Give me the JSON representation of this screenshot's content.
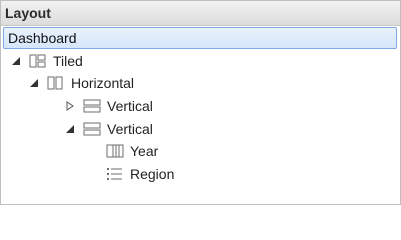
{
  "header": {
    "title": "Layout"
  },
  "root": {
    "label": "Dashboard"
  },
  "tree": [
    {
      "label": "Tiled",
      "icon": "tiled-layout-icon",
      "expander": "expanded"
    },
    {
      "label": "Horizontal",
      "icon": "horizontal-layout-icon",
      "expander": "expanded"
    },
    {
      "label": "Vertical",
      "icon": "vertical-layout-icon",
      "expander": "collapsed"
    },
    {
      "label": "Vertical",
      "icon": "vertical-layout-icon",
      "expander": "expanded"
    },
    {
      "label": "Year",
      "icon": "year-chart-icon",
      "expander": "none"
    },
    {
      "label": "Region",
      "icon": "region-list-icon",
      "expander": "none"
    }
  ],
  "colors": {
    "selection_border": "#7fa9e3",
    "icon_stroke": "#6e6e6e"
  }
}
